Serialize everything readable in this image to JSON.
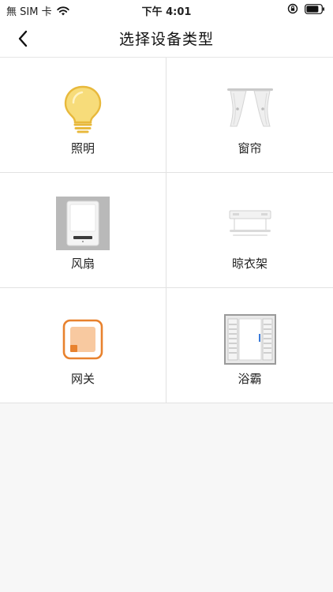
{
  "status_bar": {
    "carrier": "無 SIM 卡",
    "time": "下午 4:01",
    "wifi_icon": "wifi-icon",
    "orientation_lock_icon": "orientation-lock-icon",
    "battery_icon": "battery-icon"
  },
  "nav": {
    "back_icon": "chevron-left-icon",
    "title": "选择设备类型"
  },
  "devices": [
    {
      "label": "照明",
      "icon": "light-bulb-icon"
    },
    {
      "label": "窗帘",
      "icon": "curtain-icon"
    },
    {
      "label": "风扇",
      "icon": "fan-heater-icon"
    },
    {
      "label": "晾衣架",
      "icon": "clothes-rack-icon"
    },
    {
      "label": "网关",
      "icon": "gateway-icon"
    },
    {
      "label": "浴霸",
      "icon": "bath-heater-icon"
    }
  ],
  "colors": {
    "accent_orange": "#E8822E",
    "bulb_yellow": "#F2C94C",
    "page_bg": "#F7F7F7",
    "grid_line": "#E2E2E2"
  }
}
